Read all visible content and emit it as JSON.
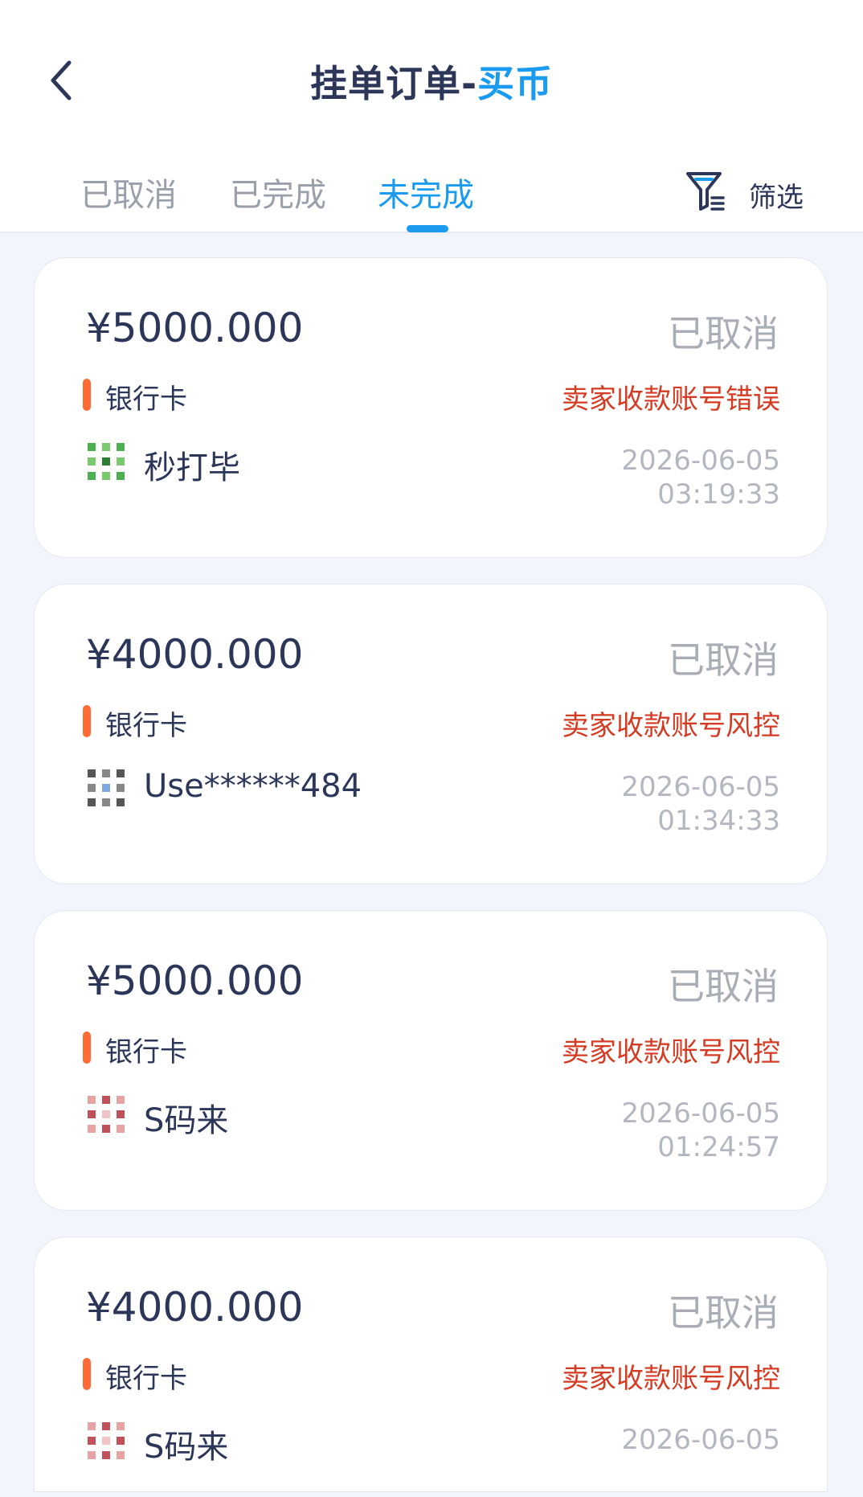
{
  "header": {
    "title_main": "挂单订单-",
    "title_accent": "买币",
    "back_icon": "chevron-left-icon"
  },
  "tabs": [
    {
      "label": "已取消",
      "active": false
    },
    {
      "label": "已完成",
      "active": false
    },
    {
      "label": "未完成",
      "active": true
    }
  ],
  "filter": {
    "label": "筛选",
    "icon": "filter-funnel-icon"
  },
  "colors": {
    "accent": "#1a9bf0",
    "text_primary": "#2b3658",
    "status_gray": "#a9adb5",
    "reason_red": "#d53a22",
    "method_bar": "#ff6b35",
    "background": "#f2f5fb"
  },
  "orders": [
    {
      "amount": "¥5000.000",
      "status": "已取消",
      "method": "银行卡",
      "reason": "卖家收款账号错误",
      "user": "秒打毕",
      "avatar": "green-pattern-avatar",
      "date": "2026-06-05",
      "time": "03:19:33"
    },
    {
      "amount": "¥4000.000",
      "status": "已取消",
      "method": "银行卡",
      "reason": "卖家收款账号风控",
      "user": "Use******484",
      "avatar": "gray-pattern-avatar",
      "date": "2026-06-05",
      "time": "01:34:33"
    },
    {
      "amount": "¥5000.000",
      "status": "已取消",
      "method": "银行卡",
      "reason": "卖家收款账号风控",
      "user": "S码来",
      "avatar": "red-pattern-avatar",
      "date": "2026-06-05",
      "time": "01:24:57"
    },
    {
      "amount": "¥4000.000",
      "status": "已取消",
      "method": "银行卡",
      "reason": "卖家收款账号风控",
      "user": "S码来",
      "avatar": "red-pattern-avatar",
      "date": "2026-06-05",
      "time": ""
    }
  ]
}
